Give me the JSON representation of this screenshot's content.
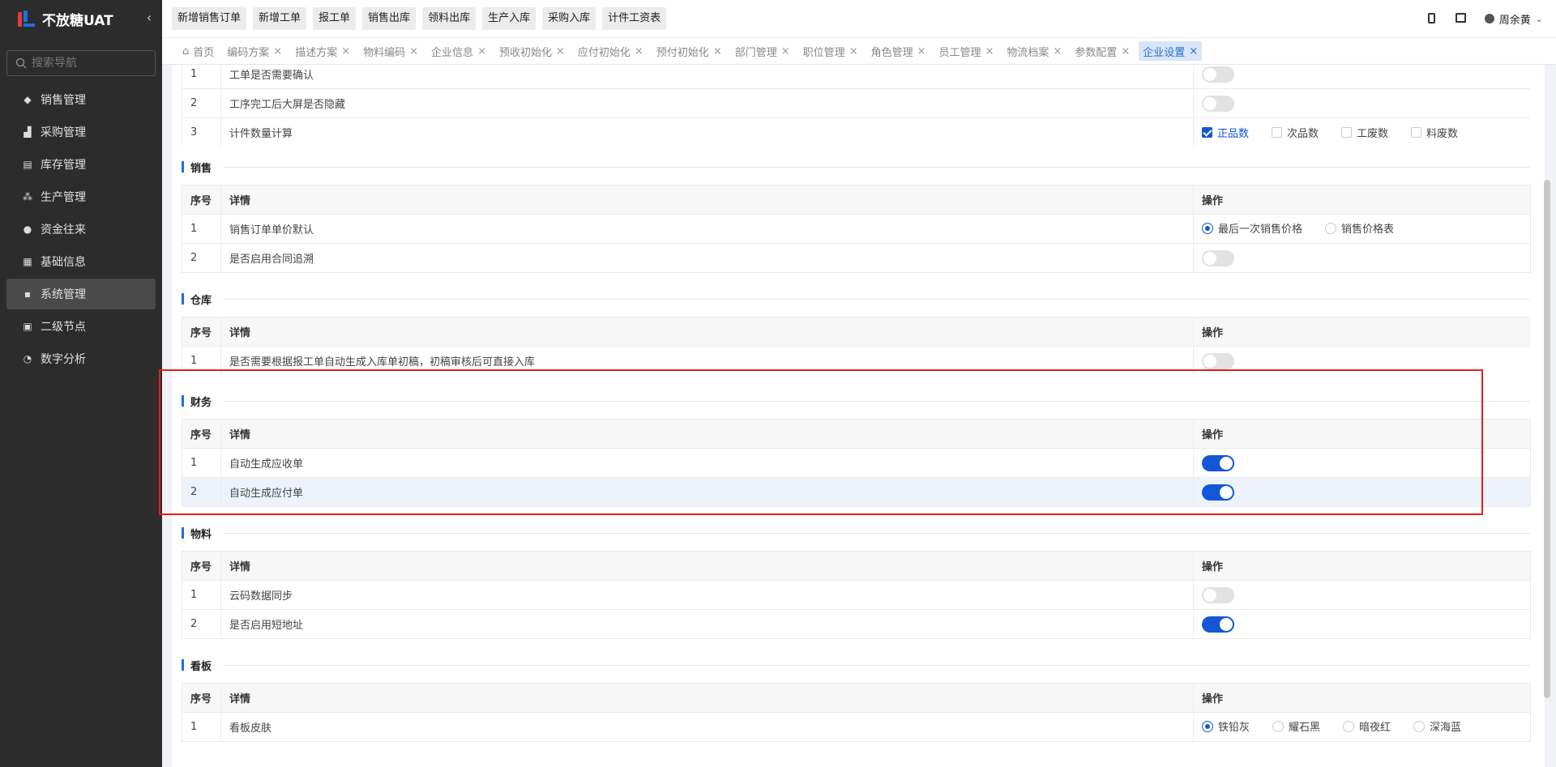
{
  "app": {
    "title": "不放糖UAT"
  },
  "sidebar": {
    "search_placeholder": "搜索导航",
    "items": [
      {
        "label": "销售管理",
        "icon": "tag-icon"
      },
      {
        "label": "采购管理",
        "icon": "cart-icon"
      },
      {
        "label": "库存管理",
        "icon": "warehouse-icon"
      },
      {
        "label": "生产管理",
        "icon": "production-icon"
      },
      {
        "label": "资金往来",
        "icon": "money-icon"
      },
      {
        "label": "基础信息",
        "icon": "grid-icon"
      },
      {
        "label": "系统管理",
        "icon": "apps-icon",
        "active": true
      },
      {
        "label": "二级节点",
        "icon": "document-icon"
      },
      {
        "label": "数字分析",
        "icon": "pie-chart-icon"
      }
    ]
  },
  "toolbar": {
    "quick_buttons": [
      "新增销售订单",
      "新增工单",
      "报工单",
      "销售出库",
      "领料出库",
      "生产入库",
      "采购入库",
      "计件工资表"
    ],
    "user_name": "周余黄"
  },
  "tabs": {
    "home": "首页",
    "items": [
      "编码方案",
      "描述方案",
      "物料编码",
      "企业信息",
      "预收初始化",
      "应付初始化",
      "预付初始化",
      "部门管理",
      "职位管理",
      "角色管理",
      "员工管理",
      "物流档案",
      "参数配置",
      "企业设置"
    ],
    "active": "企业设置"
  },
  "table_headers": {
    "index": "序号",
    "detail": "详情",
    "action": "操作"
  },
  "production": {
    "rows": [
      {
        "index": "1",
        "detail": "工单是否需要确认",
        "toggle": false
      },
      {
        "index": "2",
        "detail": "工序完工后大屏是否隐藏",
        "toggle": false
      },
      {
        "index": "3",
        "detail": "计件数量计算",
        "checks": [
          {
            "label": "正品数",
            "checked": true
          },
          {
            "label": "次品数",
            "checked": false
          },
          {
            "label": "工废数",
            "checked": false
          },
          {
            "label": "料废数",
            "checked": false
          }
        ]
      }
    ]
  },
  "sales": {
    "title": "销售",
    "rows": [
      {
        "index": "1",
        "detail": "销售订单单价默认",
        "radios": [
          {
            "label": "最后一次销售价格",
            "selected": true
          },
          {
            "label": "销售价格表",
            "selected": false
          }
        ]
      },
      {
        "index": "2",
        "detail": "是否启用合同追溯",
        "toggle": false
      }
    ]
  },
  "warehouse": {
    "title": "仓库",
    "rows": [
      {
        "index": "1",
        "detail": "是否需要根据报工单自动生成入库单初稿，初稿审核后可直接入库",
        "toggle": false
      }
    ]
  },
  "finance": {
    "title": "财务",
    "rows": [
      {
        "index": "1",
        "detail": "自动生成应收单",
        "toggle": true
      },
      {
        "index": "2",
        "detail": "自动生成应付单",
        "toggle": true
      }
    ]
  },
  "material": {
    "title": "物料",
    "rows": [
      {
        "index": "1",
        "detail": "云码数据同步",
        "toggle": false
      },
      {
        "index": "2",
        "detail": "是否启用短地址",
        "toggle": true
      }
    ]
  },
  "board": {
    "title": "看板",
    "rows": [
      {
        "index": "1",
        "detail": "看板皮肤",
        "radios": [
          {
            "label": "铁铅灰",
            "selected": true
          },
          {
            "label": "耀石黑",
            "selected": false
          },
          {
            "label": "暗夜红",
            "selected": false
          },
          {
            "label": "深海蓝",
            "selected": false
          }
        ]
      }
    ]
  },
  "colors": {
    "accent": "#1457d6",
    "sidebar_bg": "#2c2c2c",
    "highlight": "#e0201a"
  }
}
